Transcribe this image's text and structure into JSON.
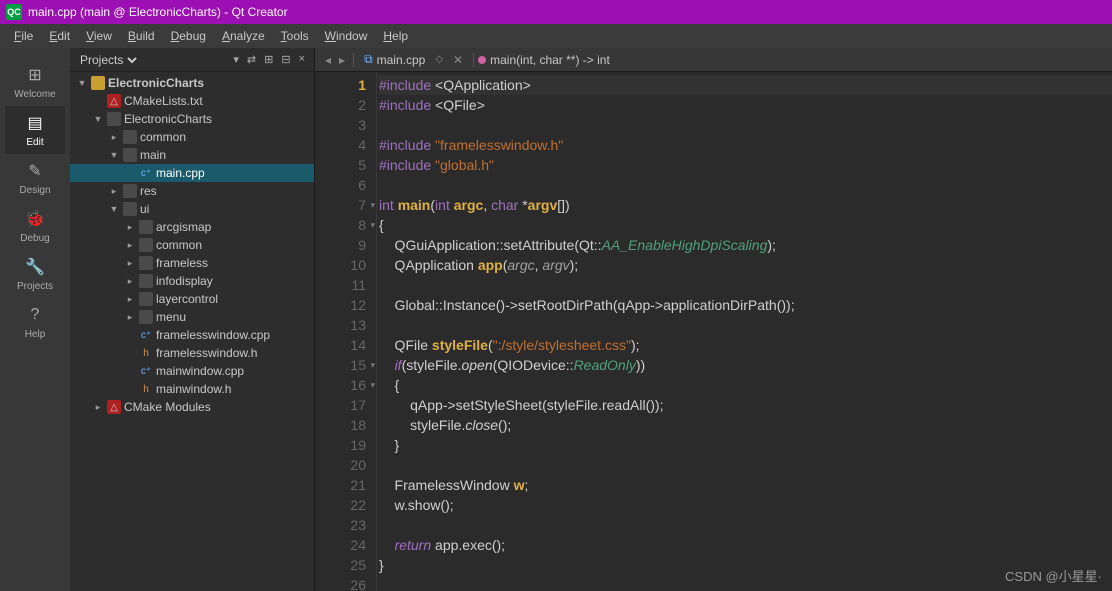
{
  "title": "main.cpp (main @ ElectronicCharts) - Qt Creator",
  "menu": [
    "File",
    "Edit",
    "View",
    "Build",
    "Debug",
    "Analyze",
    "Tools",
    "Window",
    "Help"
  ],
  "sidebar": [
    {
      "label": "Welcome",
      "icon": "⊞"
    },
    {
      "label": "Edit",
      "icon": "▤",
      "active": true
    },
    {
      "label": "Design",
      "icon": "✎"
    },
    {
      "label": "Debug",
      "icon": "🐞"
    },
    {
      "label": "Projects",
      "icon": "🔧"
    },
    {
      "label": "Help",
      "icon": "?"
    }
  ],
  "pane": {
    "selector": "Projects"
  },
  "tree": [
    {
      "depth": 0,
      "arrow": "▼",
      "icon": "proj",
      "label": "ElectronicCharts",
      "bold": true
    },
    {
      "depth": 1,
      "arrow": "",
      "icon": "cmake",
      "label": "CMakeLists.txt"
    },
    {
      "depth": 1,
      "arrow": "▼",
      "icon": "folder",
      "label": "ElectronicCharts"
    },
    {
      "depth": 2,
      "arrow": "▸",
      "icon": "folder",
      "label": "common"
    },
    {
      "depth": 2,
      "arrow": "▼",
      "icon": "folder",
      "label": "main"
    },
    {
      "depth": 3,
      "arrow": "",
      "icon": "cpp",
      "label": "main.cpp",
      "sel": true
    },
    {
      "depth": 2,
      "arrow": "▸",
      "icon": "folder",
      "label": "res"
    },
    {
      "depth": 2,
      "arrow": "▼",
      "icon": "folder",
      "label": "ui"
    },
    {
      "depth": 3,
      "arrow": "▸",
      "icon": "folder",
      "label": "arcgismap"
    },
    {
      "depth": 3,
      "arrow": "▸",
      "icon": "folder",
      "label": "common"
    },
    {
      "depth": 3,
      "arrow": "▸",
      "icon": "folder",
      "label": "frameless"
    },
    {
      "depth": 3,
      "arrow": "▸",
      "icon": "folder",
      "label": "infodisplay"
    },
    {
      "depth": 3,
      "arrow": "▸",
      "icon": "folder",
      "label": "layercontrol"
    },
    {
      "depth": 3,
      "arrow": "▸",
      "icon": "folder",
      "label": "menu"
    },
    {
      "depth": 3,
      "arrow": "",
      "icon": "cpp",
      "label": "framelesswindow.cpp"
    },
    {
      "depth": 3,
      "arrow": "",
      "icon": "h",
      "label": "framelesswindow.h"
    },
    {
      "depth": 3,
      "arrow": "",
      "icon": "cpp",
      "label": "mainwindow.cpp"
    },
    {
      "depth": 3,
      "arrow": "",
      "icon": "h",
      "label": "mainwindow.h"
    },
    {
      "depth": 1,
      "arrow": "▸",
      "icon": "cmake",
      "label": "CMake Modules"
    }
  ],
  "editor": {
    "file": "main.cpp",
    "breadcrumb": "main(int, char **) -> int",
    "lines": 26,
    "current_line": 1,
    "code": [
      [
        [
          "hash",
          "#include "
        ],
        [
          "op",
          "<"
        ],
        [
          "id",
          "QApplication"
        ],
        [
          "op",
          ">"
        ]
      ],
      [
        [
          "hash",
          "#include "
        ],
        [
          "op",
          "<"
        ],
        [
          "id",
          "QFile"
        ],
        [
          "op",
          ">"
        ]
      ],
      [],
      [
        [
          "hash",
          "#include "
        ],
        [
          "str",
          "\"framelesswindow.h\""
        ]
      ],
      [
        [
          "hash",
          "#include "
        ],
        [
          "str",
          "\"global.h\""
        ]
      ],
      [],
      [
        [
          "kw",
          "int "
        ],
        [
          "fn",
          "main"
        ],
        [
          "op",
          "("
        ],
        [
          "kw",
          "int "
        ],
        [
          "fn",
          "argc"
        ],
        [
          "op",
          ", "
        ],
        [
          "kw",
          "char "
        ],
        [
          "op",
          "*"
        ],
        [
          "fn",
          "argv"
        ],
        [
          "op",
          "[])"
        ]
      ],
      [
        [
          "op",
          "{"
        ]
      ],
      [
        [
          "id",
          "    QGuiApplication"
        ],
        [
          "op",
          "::"
        ],
        [
          "id",
          "setAttribute"
        ],
        [
          "op",
          "("
        ],
        [
          "id",
          "Qt"
        ],
        [
          "op",
          "::"
        ],
        [
          "enum",
          "AA_EnableHighDpiScaling"
        ],
        [
          "op",
          ");"
        ]
      ],
      [
        [
          "id",
          "    QApplication "
        ],
        [
          "fn",
          "app"
        ],
        [
          "op",
          "("
        ],
        [
          "param",
          "argc"
        ],
        [
          "op",
          ", "
        ],
        [
          "param",
          "argv"
        ],
        [
          "op",
          ");"
        ]
      ],
      [],
      [
        [
          "id",
          "    Global"
        ],
        [
          "op",
          "::"
        ],
        [
          "id",
          "Instance"
        ],
        [
          "op",
          "()->"
        ],
        [
          "id",
          "setRootDirPath"
        ],
        [
          "op",
          "("
        ],
        [
          "id",
          "qApp"
        ],
        [
          "op",
          "->"
        ],
        [
          "id",
          "applicationDirPath"
        ],
        [
          "op",
          "());"
        ]
      ],
      [],
      [
        [
          "id",
          "    QFile "
        ],
        [
          "fn",
          "styleFile"
        ],
        [
          "op",
          "("
        ],
        [
          "str",
          "\":/style/stylesheet.css\""
        ],
        [
          "op",
          ");"
        ]
      ],
      [
        [
          "op",
          "    "
        ],
        [
          "kwit",
          "if"
        ],
        [
          "op",
          "("
        ],
        [
          "id",
          "styleFile"
        ],
        [
          "op",
          "."
        ],
        [
          "it",
          "open"
        ],
        [
          "op",
          "("
        ],
        [
          "id",
          "QIODevice"
        ],
        [
          "op",
          "::"
        ],
        [
          "enum",
          "ReadOnly"
        ],
        [
          "op",
          "))"
        ]
      ],
      [
        [
          "op",
          "    {"
        ]
      ],
      [
        [
          "id",
          "        qApp"
        ],
        [
          "op",
          "->"
        ],
        [
          "id",
          "setStyleSheet"
        ],
        [
          "op",
          "("
        ],
        [
          "id",
          "styleFile"
        ],
        [
          "op",
          "."
        ],
        [
          "id",
          "readAll"
        ],
        [
          "op",
          "());"
        ]
      ],
      [
        [
          "id",
          "        styleFile"
        ],
        [
          "op",
          "."
        ],
        [
          "it",
          "close"
        ],
        [
          "op",
          "();"
        ]
      ],
      [
        [
          "op",
          "    }"
        ]
      ],
      [],
      [
        [
          "id",
          "    FramelessWindow "
        ],
        [
          "fn",
          "w"
        ],
        [
          "op",
          ";"
        ]
      ],
      [
        [
          "id",
          "    w"
        ],
        [
          "op",
          "."
        ],
        [
          "id",
          "show"
        ],
        [
          "op",
          "();"
        ]
      ],
      [],
      [
        [
          "op",
          "    "
        ],
        [
          "kwit",
          "return"
        ],
        [
          "id",
          " app"
        ],
        [
          "op",
          "."
        ],
        [
          "id",
          "exec"
        ],
        [
          "op",
          "();"
        ]
      ],
      [
        [
          "op",
          "}"
        ]
      ],
      []
    ]
  },
  "watermark": "CSDN @小星星·"
}
